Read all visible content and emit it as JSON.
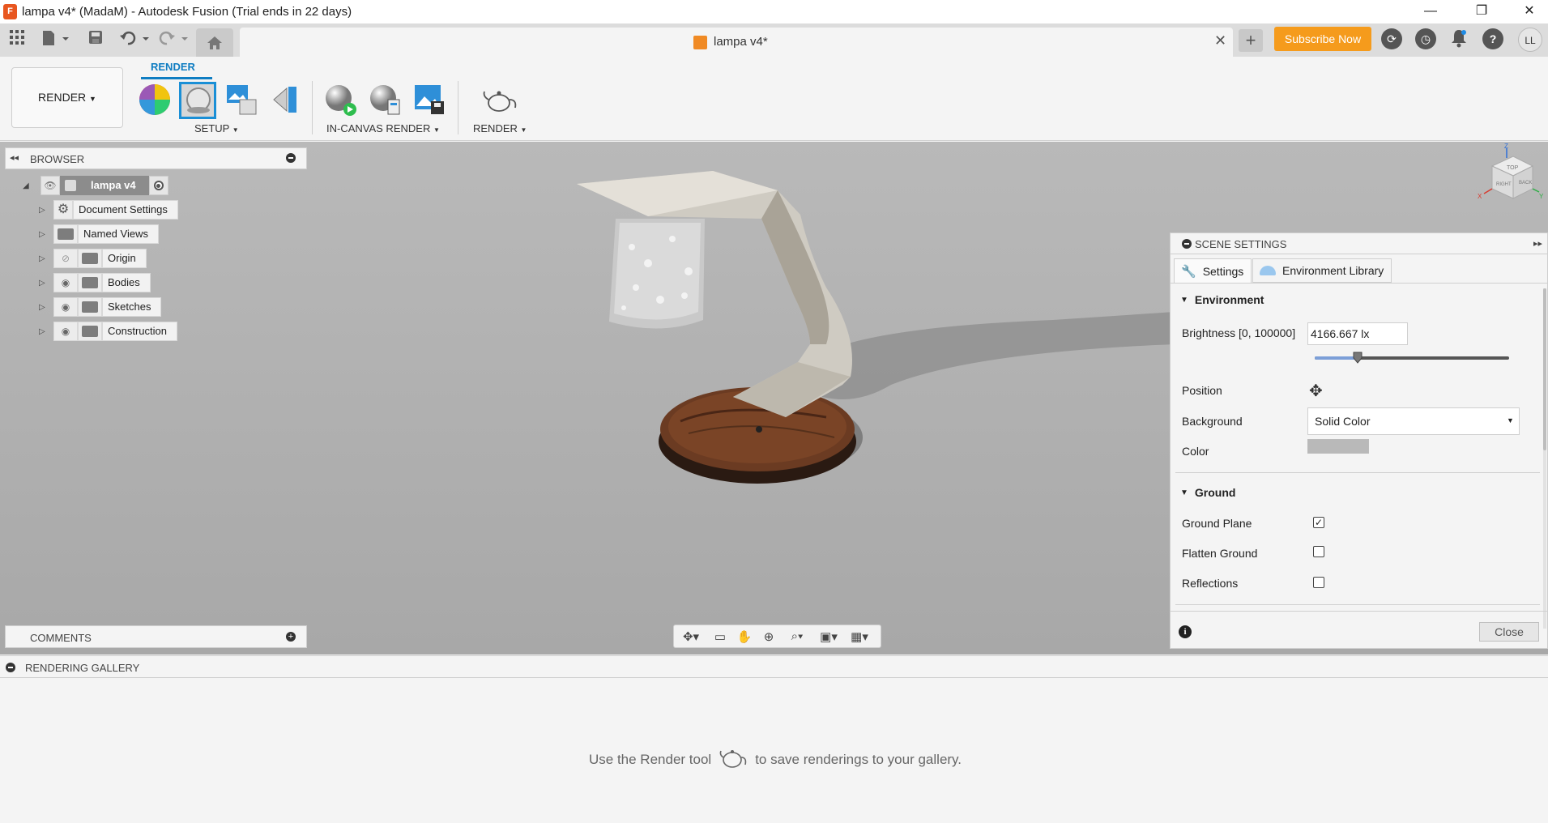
{
  "window": {
    "title": "lampa v4* (MadaM) - Autodesk Fusion (Trial ends in 22 days)",
    "app_icon_letter": "F",
    "minimize": "—",
    "maximize": "❐",
    "close": "✕"
  },
  "tabbar": {
    "doc_tab_label": "lampa v4*",
    "subscribe_label": "Subscribe Now",
    "avatar_initials": "LL"
  },
  "toolbar": {
    "workspace_label": "RENDER",
    "active_tab": "RENDER",
    "groups": {
      "setup": "SETUP",
      "in_canvas_render": "IN-CANVAS RENDER",
      "render": "RENDER"
    }
  },
  "browser": {
    "title": "BROWSER",
    "root": "lampa v4",
    "items": [
      {
        "label": "Document Settings",
        "icon": "gear-icon",
        "visible": null
      },
      {
        "label": "Named Views",
        "icon": "folder-icon",
        "visible": null
      },
      {
        "label": "Origin",
        "icon": "folder-icon",
        "visible": false
      },
      {
        "label": "Bodies",
        "icon": "folder-icon",
        "visible": true
      },
      {
        "label": "Sketches",
        "icon": "folder-icon",
        "visible": true
      },
      {
        "label": "Construction",
        "icon": "folder-icon",
        "visible": true
      }
    ]
  },
  "comments": {
    "title": "COMMENTS"
  },
  "scene_settings": {
    "title": "SCENE SETTINGS",
    "tabs": [
      "Settings",
      "Environment Library"
    ],
    "environment": {
      "title": "Environment",
      "brightness_label": "Brightness [0, 100000]",
      "brightness_value": "4166.667 lx",
      "brightness_fraction": 0.22,
      "position_label": "Position",
      "background_label": "Background",
      "background_value": "Solid Color",
      "color_label": "Color",
      "color_hex": "#b9b9b9"
    },
    "ground": {
      "title": "Ground",
      "ground_plane_label": "Ground Plane",
      "ground_plane_checked": true,
      "flatten_label": "Flatten Ground",
      "flatten_checked": false,
      "reflections_label": "Reflections",
      "reflections_checked": false
    },
    "close_label": "Close"
  },
  "gallery": {
    "title": "RENDERING GALLERY",
    "hint_before": "Use the Render tool",
    "hint_after": "to save renderings to your gallery."
  },
  "viewcube": {
    "top": "TOP",
    "left": "RIGHT",
    "right": "BACK",
    "axis_x": "X",
    "axis_y": "Y",
    "axis_z": "Z"
  },
  "colors": {
    "accent": "#0f7dc2",
    "subscribe": "#f59b1c"
  }
}
